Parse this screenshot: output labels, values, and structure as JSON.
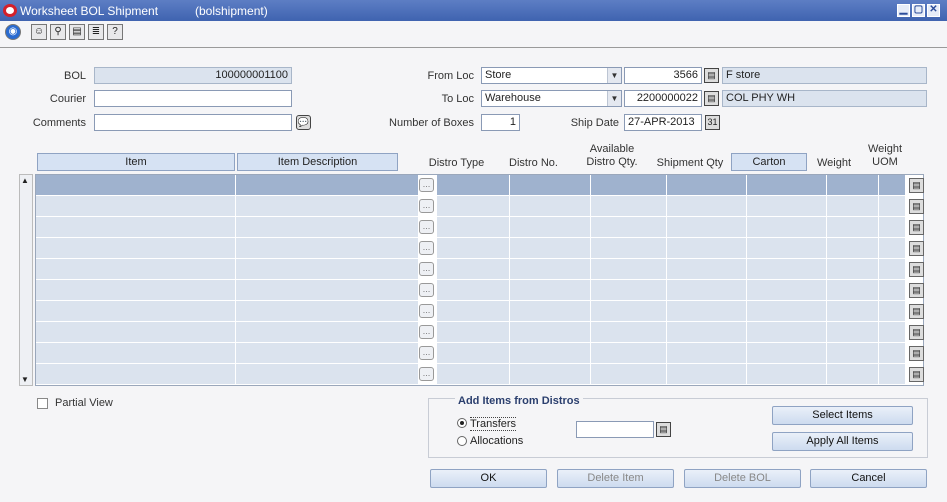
{
  "window": {
    "title": "Worksheet BOL Shipment",
    "subtitle": "(bolshipment)",
    "minimize": "▁",
    "maximize": "▢",
    "close": "✕"
  },
  "toolbar": {
    "icons": [
      "globe-icon",
      "help-face-icon",
      "find-icon",
      "print-icon",
      "list-icon",
      "help-icon"
    ]
  },
  "form": {
    "bol_label": "BOL",
    "bol_value": "100000001100",
    "courier_label": "Courier",
    "courier_value": "",
    "comments_label": "Comments",
    "comments_value": "",
    "from_loc_label": "From Loc",
    "from_loc_type": "Store",
    "from_loc_id": "3566",
    "from_loc_name": "F store",
    "to_loc_label": "To Loc",
    "to_loc_type": "Warehouse",
    "to_loc_id": "2200000022",
    "to_loc_name": "COL PHY WH",
    "boxes_label": "Number of Boxes",
    "boxes_value": "1",
    "ship_date_label": "Ship Date",
    "ship_date_value": "27-APR-2013"
  },
  "grid": {
    "headers": {
      "item": "Item",
      "item_description": "Item Description",
      "distro_type": "Distro Type",
      "distro_no": "Distro No.",
      "available_line1": "Available",
      "available_line2": "Distro Qty.",
      "shipment_qty": "Shipment Qty",
      "carton": "Carton",
      "weight": "Weight",
      "weight_uom_line1": "Weight",
      "weight_uom_line2": "UOM"
    },
    "row_count": 10
  },
  "bottom": {
    "partial_view_label": "Partial View",
    "add_items_title": "Add Items from Distros",
    "transfers_label": "Transfers",
    "allocations_label": "Allocations",
    "distro_input_value": "",
    "select_items_label": "Select Items",
    "apply_all_items_label": "Apply All Items",
    "ok_label": "OK",
    "delete_item_label": "Delete Item",
    "delete_bol_label": "Delete BOL",
    "cancel_label": "Cancel"
  }
}
